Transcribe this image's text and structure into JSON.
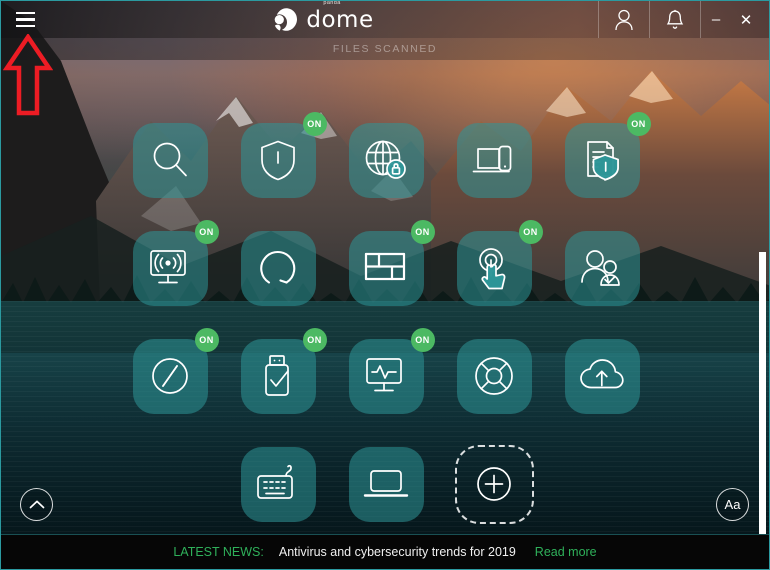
{
  "window": {
    "app_title": "dome",
    "logo_superscript": "panda",
    "menu_icon": "hamburger-menu-icon",
    "account_icon": "user-account-icon",
    "notifications_icon": "bell-notification-icon",
    "minimize_label": "–",
    "close_label": "✕",
    "accent_color": "#2b9aa0",
    "badge_color": "#4cb963",
    "news_accent_color": "#2fb05a"
  },
  "status_strip": {
    "label": "FILES SCANNED"
  },
  "tiles": [
    {
      "id": "scan",
      "name": "scan-tile",
      "icon": "magnifier-icon",
      "badge": "",
      "badge_on": false
    },
    {
      "id": "antivirus",
      "name": "antivirus-shield-tile",
      "icon": "shield-icon",
      "badge": "ON",
      "badge_on": true
    },
    {
      "id": "vpn",
      "name": "vpn-globe-lock-tile",
      "icon": "globe-lock-icon",
      "badge": "",
      "badge_on": false
    },
    {
      "id": "my-devices",
      "name": "my-devices-tile",
      "icon": "laptop-phone-icon",
      "badge": "",
      "badge_on": false
    },
    {
      "id": "data-shield",
      "name": "data-shield-tile",
      "icon": "document-shield-icon",
      "badge": "ON",
      "badge_on": true
    },
    {
      "id": "wifi-protection",
      "name": "wifi-protection-tile",
      "icon": "monitor-wifi-icon",
      "badge": "ON",
      "badge_on": true
    },
    {
      "id": "optimization",
      "name": "optimization-tile",
      "icon": "arc-gauge-icon",
      "badge": "",
      "badge_on": false
    },
    {
      "id": "firewall",
      "name": "firewall-tile",
      "icon": "firewall-grid-icon",
      "badge": "ON",
      "badge_on": true
    },
    {
      "id": "app-control",
      "name": "application-control-tile",
      "icon": "hand-touch-icon",
      "badge": "ON",
      "badge_on": true
    },
    {
      "id": "parental-control",
      "name": "parental-control-tile",
      "icon": "two-users-icon",
      "badge": "",
      "badge_on": false
    },
    {
      "id": "safe-browsing",
      "name": "safe-browsing-tile",
      "icon": "compass-icon",
      "badge": "ON",
      "badge_on": true
    },
    {
      "id": "usb-protection",
      "name": "usb-protection-tile",
      "icon": "usb-check-icon",
      "badge": "ON",
      "badge_on": true
    },
    {
      "id": "process-monitor",
      "name": "process-monitor-tile",
      "icon": "monitor-pulse-icon",
      "badge": "ON",
      "badge_on": true
    },
    {
      "id": "rescue-kit",
      "name": "rescue-kit-tile",
      "icon": "life-ring-icon",
      "badge": "",
      "badge_on": false
    },
    {
      "id": "cloud-backup",
      "name": "cloud-backup-tile",
      "icon": "cloud-upload-icon",
      "badge": "",
      "badge_on": false
    },
    {
      "id": "blank-1",
      "name": "empty-slot",
      "icon": "",
      "badge": "",
      "badge_on": false
    },
    {
      "id": "virtual-keyboard",
      "name": "virtual-keyboard-tile",
      "icon": "keyboard-icon",
      "badge": "",
      "badge_on": false
    },
    {
      "id": "remote-access",
      "name": "remote-access-tile",
      "icon": "laptop-icon",
      "badge": "",
      "badge_on": false
    },
    {
      "id": "add-service",
      "name": "add-service-tile",
      "icon": "plus-circle-icon",
      "badge": "",
      "badge_on": false
    },
    {
      "id": "blank-2",
      "name": "empty-slot",
      "icon": "",
      "badge": "",
      "badge_on": false
    }
  ],
  "floating_buttons": {
    "scroll_up": {
      "name": "scroll-up-button",
      "icon": "chevron-up-icon"
    },
    "text_size": {
      "name": "text-size-button",
      "label": "Aa"
    }
  },
  "news_bar": {
    "label": "LATEST NEWS:",
    "headline": "Antivirus and cybersecurity trends for 2019",
    "link_label": "Read more"
  },
  "annotation": {
    "arrow": "red-up-arrow-pointing-at-menu",
    "arrow_color": "#ed1c24"
  }
}
